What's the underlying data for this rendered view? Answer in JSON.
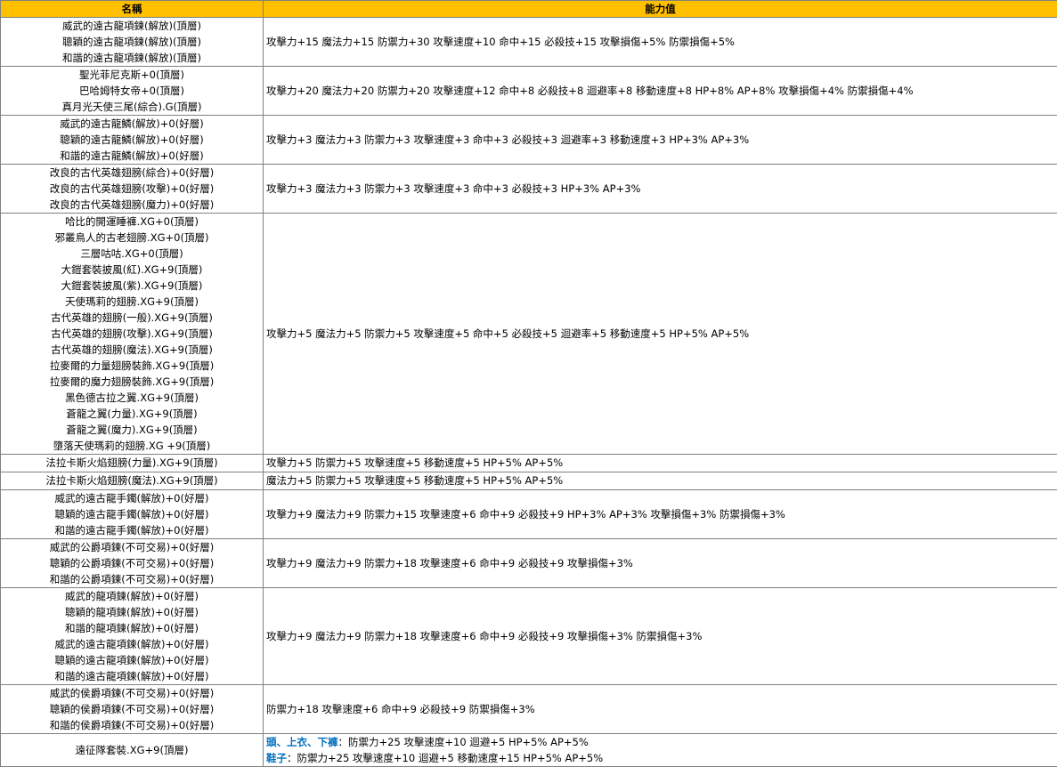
{
  "header": {
    "name": "名稱",
    "ability": "能力值"
  },
  "rows": [
    {
      "names": [
        "威武的遠古龍項鍊(解放)(頂層)",
        "聰穎的遠古龍項鍊(解放)(頂層)",
        "和諧的遠古龍項鍊(解放)(頂層)"
      ],
      "stats": "攻擊力+15 魔法力+15 防禦力+30 攻擊速度+10 命中+15 必殺技+15 攻擊損傷+5% 防禦損傷+5%"
    },
    {
      "names": [
        "聖光菲尼克斯+0(頂層)",
        "巴哈姆特女帝+0(頂層)",
        "真月光天使三尾(綜合).G(頂層)"
      ],
      "stats": "攻擊力+20 魔法力+20 防禦力+20 攻擊速度+12 命中+8 必殺技+8 迴避率+8 移動速度+8 HP+8% AP+8% 攻擊損傷+4% 防禦損傷+4%"
    },
    {
      "names": [
        "威武的遠古龍鱗(解放)+0(好層)",
        "聰穎的遠古龍鱗(解放)+0(好層)",
        "和諧的遠古龍鱗(解放)+0(好層)"
      ],
      "stats": "攻擊力+3 魔法力+3 防禦力+3 攻擊速度+3 命中+3 必殺技+3 迴避率+3 移動速度+3  HP+3% AP+3%"
    },
    {
      "names": [
        "改良的古代英雄翅膀(綜合)+0(好層)",
        "改良的古代英雄翅膀(攻擊)+0(好層)",
        "改良的古代英雄翅膀(魔力)+0(好層)"
      ],
      "stats": "攻擊力+3 魔法力+3 防禦力+3 攻擊速度+3 命中+3 必殺技+3 HP+3% AP+3%"
    },
    {
      "names": [
        "哈比的開運睡褲.XG+0(頂層)",
        "邪叢鳥人的古老翅膀.XG+0(頂層)",
        "三層咕咕.XG+0(頂層)",
        "大鎧套裝披風(紅).XG+9(頂層)",
        "大鎧套裝披風(紫).XG+9(頂層)",
        "天使瑪莉的翅膀.XG+9(頂層)",
        "古代英雄的翅膀(一般).XG+9(頂層)",
        "古代英雄的翅膀(攻擊).XG+9(頂層)",
        "古代英雄的翅膀(魔法).XG+9(頂層)",
        "拉麥爾的力量翅膀裝飾.XG+9(頂層)",
        "拉麥爾的魔力翅膀裝飾.XG+9(頂層)",
        "黑色德古拉之翼.XG+9(頂層)",
        "蒼龍之翼(力量).XG+9(頂層)",
        "蒼龍之翼(魔力).XG+9(頂層)",
        "墮落天使瑪莉的翅膀.XG +9(頂層)"
      ],
      "stats": "攻擊力+5 魔法力+5 防禦力+5 攻擊速度+5 命中+5 必殺技+5 迴避率+5 移動速度+5  HP+5% AP+5%"
    },
    {
      "names": [
        "法拉卡斯火焰翅膀(力量).XG+9(頂層)"
      ],
      "stats": "攻擊力+5 防禦力+5 攻擊速度+5 移動速度+5 HP+5% AP+5%"
    },
    {
      "names": [
        "法拉卡斯火焰翅膀(魔法).XG+9(頂層)"
      ],
      "stats": "魔法力+5 防禦力+5 攻擊速度+5 移動速度+5 HP+5% AP+5%"
    },
    {
      "names": [
        "威武的遠古龍手鐲(解放)+0(好層)",
        "聰穎的遠古龍手鐲(解放)+0(好層)",
        "和諧的遠古龍手鐲(解放)+0(好層)"
      ],
      "stats": "攻擊力+9 魔法力+9 防禦力+15 攻擊速度+6 命中+9 必殺技+9  HP+3% AP+3% 攻擊損傷+3% 防禦損傷+3%"
    },
    {
      "names": [
        "威武的公爵項鍊(不可交易)+0(好層)",
        "聰穎的公爵項鍊(不可交易)+0(好層)",
        "和諧的公爵項鍊(不可交易)+0(好層)"
      ],
      "stats": "攻擊力+9 魔法力+9 防禦力+18 攻擊速度+6 命中+9 必殺技+9 攻擊損傷+3%"
    },
    {
      "names": [
        "威武的龍項鍊(解放)+0(好層)",
        "聰穎的龍項鍊(解放)+0(好層)",
        "和諧的龍項鍊(解放)+0(好層)",
        "威武的遠古龍項鍊(解放)+0(好層)",
        "聰穎的遠古龍項鍊(解放)+0(好層)",
        "和諧的遠古龍項鍊(解放)+0(好層)"
      ],
      "stats": "攻擊力+9 魔法力+9 防禦力+18 攻擊速度+6 命中+9 必殺技+9 攻擊損傷+3% 防禦損傷+3%"
    },
    {
      "names": [
        "威武的侯爵項鍊(不可交易)+0(好層)",
        "聰穎的侯爵項鍊(不可交易)+0(好層)",
        "和諧的侯爵項鍊(不可交易)+0(好層)"
      ],
      "stats": "防禦力+18 攻擊速度+6 命中+9 必殺技+9  防禦損傷+3%"
    }
  ],
  "last_row": {
    "name": "遠征隊套裝.XG+9(頂層)",
    "line1_prefix": "頭、上衣、下褲",
    "line1_rest": "：防禦力+25 攻擊速度+10 迴避+5 HP+5% AP+5%",
    "line2_prefix": "鞋子",
    "line2_rest": "：防禦力+25 攻擊速度+10 迴避+5 移動速度+15 HP+5% AP+5%"
  }
}
